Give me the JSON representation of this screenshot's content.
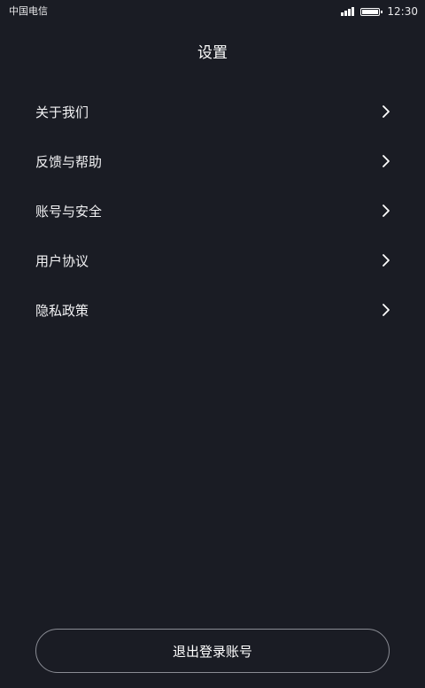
{
  "status_bar": {
    "carrier": "中国电信",
    "time": "12:30",
    "signal_bars": 4,
    "battery_level": 1.0
  },
  "header": {
    "title": "设置"
  },
  "menu": {
    "items": [
      {
        "label": "关于我们",
        "icon": "chevron-right-icon"
      },
      {
        "label": "反馈与帮助",
        "icon": "chevron-right-icon"
      },
      {
        "label": "账号与安全",
        "icon": "chevron-right-icon"
      },
      {
        "label": "用户协议",
        "icon": "chevron-right-icon"
      },
      {
        "label": "隐私政策",
        "icon": "chevron-right-icon"
      }
    ]
  },
  "footer": {
    "logout_label": "退出登录账号"
  },
  "colors": {
    "background": "#1a1c24",
    "text": "#ffffff",
    "button_border": "#8a8c94"
  }
}
